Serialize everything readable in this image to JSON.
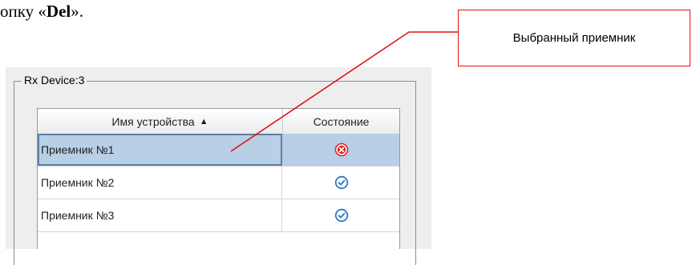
{
  "document": {
    "text_prefix": "опку «",
    "text_bold": "Del",
    "text_suffix": "»."
  },
  "callout": {
    "label": "Выбранный приемник"
  },
  "group": {
    "title": "Rx Device:3"
  },
  "table": {
    "columns": [
      "Имя устройства",
      "Состояние"
    ],
    "sort_indicator": "▲",
    "rows": [
      {
        "name": "Приемник №1",
        "status_icon": "error-x-icon",
        "selected": true
      },
      {
        "name": "Приемник №2",
        "status_icon": "check-icon",
        "selected": false
      },
      {
        "name": "Приемник №3",
        "status_icon": "check-icon",
        "selected": false
      }
    ]
  },
  "colors": {
    "callout_border": "#e01010",
    "leader_line": "#e01010",
    "selection": "#b8cfe5",
    "error_icon": "#d9252b",
    "check_icon": "#2f78c8"
  }
}
